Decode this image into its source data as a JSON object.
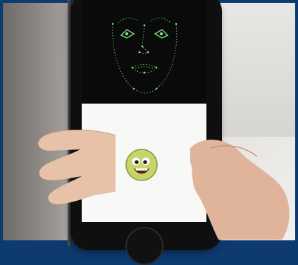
{
  "scene": {
    "frame_color": "#0d3a70",
    "mesh_color": "#7ee27a",
    "emoji": {
      "face_color": "#c5d56a",
      "rim_color": "#8a9a3a",
      "mouth_color": "#5a1f1a"
    }
  }
}
